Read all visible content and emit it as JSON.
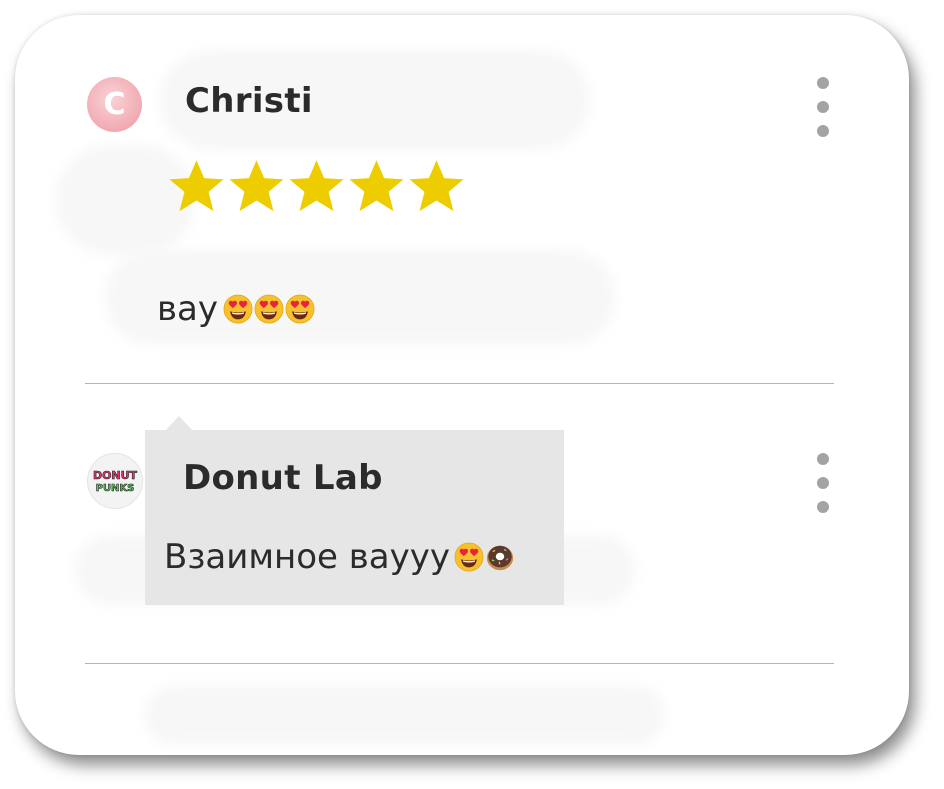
{
  "reviews": [
    {
      "avatar_letter": "C",
      "author": "Christi",
      "rating": 5,
      "rating_max": 5,
      "text": "вау",
      "emojis": [
        "heart-eyes-emoji",
        "heart-eyes-emoji",
        "heart-eyes-emoji"
      ]
    }
  ],
  "reply": {
    "author": "Donut Lab",
    "avatar_logo_line1": "DONUT",
    "avatar_logo_line2": "PUNKS",
    "text": "Взаимное ваууу",
    "emojis": [
      "heart-eyes-emoji",
      "donut-emoji"
    ]
  },
  "icons": {
    "menu": "more-vertical-icon",
    "star": "star-icon"
  },
  "colors": {
    "star": "#eecd00",
    "avatar_c": "#f1aab2",
    "reply_bg": "#e6e6e6",
    "text": "#2b2b2b",
    "kebab": "#a3a3a3",
    "divider": "#b5b5b5"
  }
}
